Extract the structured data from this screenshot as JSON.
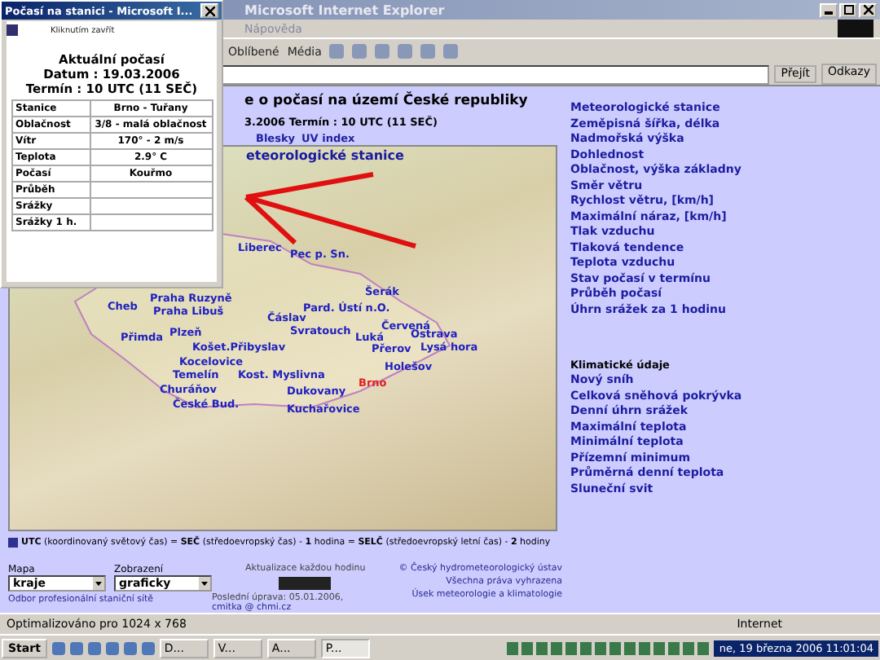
{
  "browser": {
    "title": "Microsoft Internet Explorer",
    "menu": [
      "Nápověda"
    ],
    "toolbar": [
      "Oblíbené",
      "Média"
    ],
    "go": "Přejít",
    "links_button": "Odkazy"
  },
  "page": {
    "heading": "e o počasí na území České republiky",
    "term": "3.2006 Termín : 10 UTC (11 SEČ)",
    "tabs": [
      "Blesky",
      "UV index"
    ],
    "map": {
      "title": "eteorologické stanice",
      "stations": [
        {
          "name": "Liberec",
          "selected": false
        },
        {
          "name": "Pec p. Sn.",
          "selected": false
        },
        {
          "name": "Šerák",
          "selected": false
        },
        {
          "name": "Praha Ruzyně",
          "selected": false
        },
        {
          "name": "Cheb",
          "selected": false
        },
        {
          "name": "Praha Libuš",
          "selected": false
        },
        {
          "name": "Pard. Ústí n.O.",
          "selected": false
        },
        {
          "name": "Čáslav",
          "selected": false
        },
        {
          "name": "Červená",
          "selected": false
        },
        {
          "name": "Plzeň",
          "selected": false
        },
        {
          "name": "Svratouch",
          "selected": false
        },
        {
          "name": "Přimda",
          "selected": false
        },
        {
          "name": "Luká",
          "selected": false
        },
        {
          "name": "Ostrava",
          "selected": false
        },
        {
          "name": "Košet.Přibyslav",
          "selected": false
        },
        {
          "name": "Přerov",
          "selected": false
        },
        {
          "name": "Lysá hora",
          "selected": false
        },
        {
          "name": "Kocelovice",
          "selected": false
        },
        {
          "name": "Temelín",
          "selected": false
        },
        {
          "name": "Kost. Myslivna",
          "selected": false
        },
        {
          "name": "Holešov",
          "selected": false
        },
        {
          "name": "Churáňov",
          "selected": false
        },
        {
          "name": "Dukovany",
          "selected": false
        },
        {
          "name": "Brno",
          "selected": true
        },
        {
          "name": "České Bud.",
          "selected": false
        },
        {
          "name": "Kuchařovice",
          "selected": false
        }
      ]
    },
    "legend": "**UTC** (koordinovaný světový čas) = **SEČ** (středoevropský čas) - **1** hodina = **SELČ** (středoevropský letní čas) - **2** hodiny",
    "selects": [
      {
        "label": "Mapa",
        "value": "kraje"
      },
      {
        "label": "Zobrazení",
        "value": "graficky"
      }
    ],
    "dept_link": "Odbor profesionální staniční sítě",
    "update": "Aktualizace každou hodinu",
    "modified": "Poslední úprava: 05.01.2006,",
    "email": "cmitka @ chmi.cz",
    "footer_right": [
      "© Český hydrometeorologický ústav",
      "Všechna práva vyhrazena",
      "Úsek meteorologie a klimatologie"
    ],
    "links": [
      "Meteorologické stanice",
      "Zeměpisná šířka, délka",
      "Nadmořská výška",
      "Dohlednost",
      "Oblačnost, výška základny",
      "Směr větru",
      "Rychlost větru, [km/h]",
      "Maximální náraz, [km/h]",
      "Tlak vzduchu",
      "Tlaková tendence",
      "Teplota vzduchu",
      "Stav počasí v termínu",
      "Průběh počasí",
      "Úhrn srážek za 1 hodinu"
    ],
    "climate_title": "Klimatické údaje",
    "climate_links": [
      "Nový sníh",
      "Celková sněhová pokrývka",
      "Denní úhrn srážek",
      "Maximální teplota",
      "Minimální teplota",
      "Přízemní minimum",
      "Průměrná denní teplota",
      "Sluneční svit"
    ]
  },
  "status_bar": {
    "text": "Optimalizováno pro 1024 x 768",
    "zone": "Internet"
  },
  "taskbar": {
    "start": "Start",
    "tasks": [
      {
        "label": "D...",
        "selected": false
      },
      {
        "label": "V...",
        "selected": false
      },
      {
        "label": "A...",
        "selected": false
      },
      {
        "label": "P...",
        "selected": true
      }
    ],
    "clock": "ne, 19 března 2006  11:01:04"
  },
  "popup": {
    "title": "Počasí na stanici - Microsoft I...",
    "close_link": "Kliknutím zavřít",
    "heading": "Aktuální počasí",
    "date": "Datum : 19.03.2006",
    "term": "Termín : 10 UTC (11 SEČ)",
    "rows": [
      {
        "label": "Stanice",
        "value": "Brno - Tuřany"
      },
      {
        "label": "Oblačnost",
        "value": "3/8 - malá oblačnost"
      },
      {
        "label": "Vítr",
        "value": "170° - 2 m/s"
      },
      {
        "label": "Teplota",
        "value": "2.9° C"
      },
      {
        "label": "Počasí",
        "value": "Kouřmo"
      },
      {
        "label": "Průběh"
      },
      {
        "label": "Srážky"
      },
      {
        "label": "Srážky 1 h."
      }
    ]
  }
}
